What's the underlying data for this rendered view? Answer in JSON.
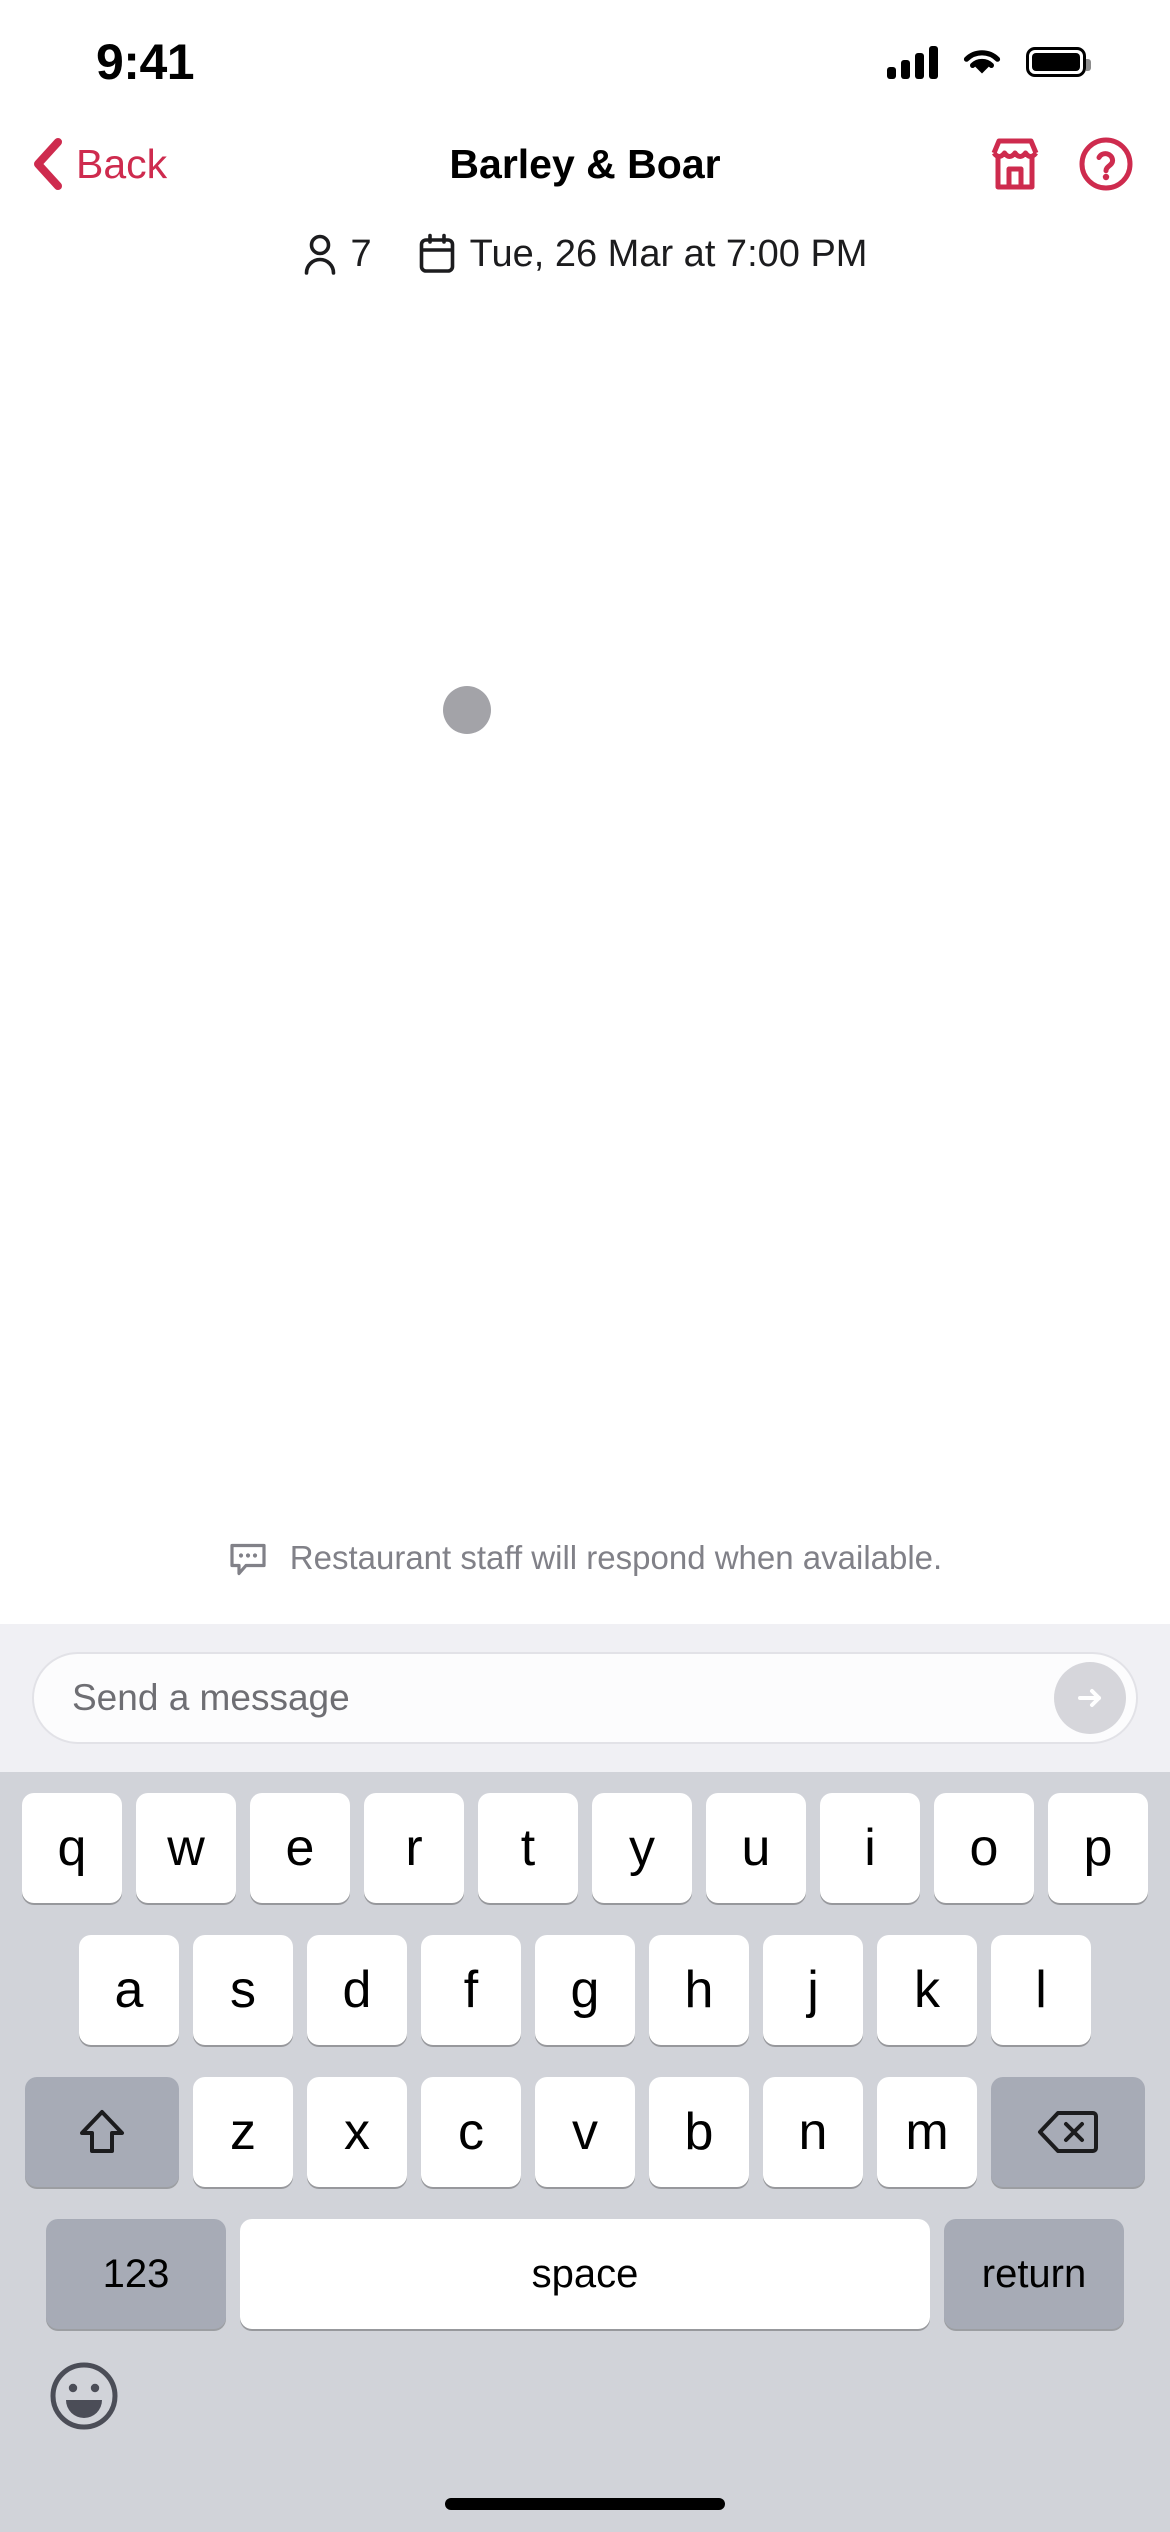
{
  "status_bar": {
    "time": "9:41",
    "cellular_icon": "cellular-bars-icon",
    "wifi_icon": "wifi-icon",
    "battery_icon": "battery-full-icon"
  },
  "nav": {
    "back_label": "Back",
    "back_icon": "chevron-left-icon",
    "title": "Barley & Boar",
    "accent_color": "#CE2B4E",
    "actions": [
      {
        "name": "restaurant-icon",
        "label": "Restaurant details"
      },
      {
        "name": "help-circle-icon",
        "label": "Help"
      }
    ]
  },
  "reservation": {
    "party_icon": "person-icon",
    "party_size": "7",
    "date_icon": "calendar-icon",
    "date_time": "Tue, 26 Mar at 7:00 PM"
  },
  "thread": {
    "loading_indicator": "loading-dot",
    "note_icon": "chat-bubble-ellipsis-icon",
    "note": "Restaurant staff will respond when available."
  },
  "composer": {
    "placeholder": "Send a message",
    "value": "",
    "send_icon": "arrow-right-circle-icon"
  },
  "keyboard": {
    "row1": [
      "q",
      "w",
      "e",
      "r",
      "t",
      "y",
      "u",
      "i",
      "o",
      "p"
    ],
    "row2": [
      "a",
      "s",
      "d",
      "f",
      "g",
      "h",
      "j",
      "k",
      "l"
    ],
    "row3": [
      "z",
      "x",
      "c",
      "v",
      "b",
      "n",
      "m"
    ],
    "shift_icon": "shift-arrow-up-icon",
    "delete_icon": "backspace-icon",
    "numbers_label": "123",
    "space_label": "space",
    "return_label": "return",
    "emoji_icon": "smiley-face-icon"
  }
}
